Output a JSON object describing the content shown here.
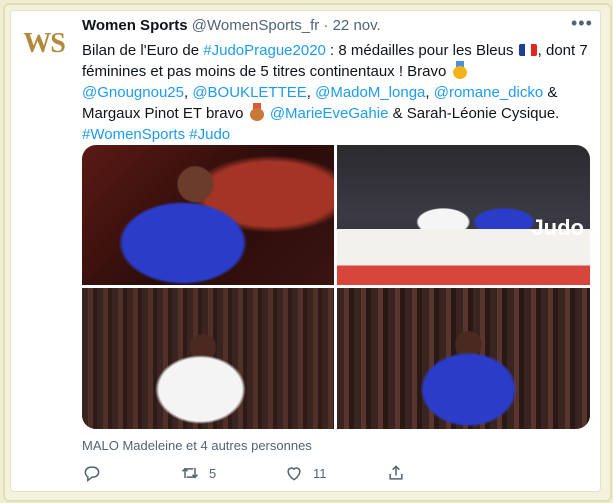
{
  "tweet": {
    "avatar_initials": "WS",
    "author_name": "Women Sports",
    "handle": "@WomenSports_fr",
    "separator": "·",
    "date": "22 nov.",
    "more_icon": "ellipsis-icon",
    "text": {
      "part1": "Bilan de l'Euro de ",
      "tag1": "#JudoPrague2020",
      "part2": " : 8 médailles pour les Bleus ",
      "part3": ", dont 7 féminines et pas moins de 5 titres continentaux ! Bravo ",
      "m1": "@Gnougnou25",
      "c1": ", ",
      "m2": "@BOUKLETTEE",
      "c2": ", ",
      "m3": "@MadoM_longa",
      "c3": ", ",
      "m4": "@romane_dicko",
      "part4": " & Margaux Pinot ET bravo ",
      "m5": "@MarieEveGahie",
      "part5": " & Sarah-Léonie Cysique.",
      "tag2": "#WomenSports",
      "tag3": "#Judo"
    },
    "photos": [
      {
        "name": "judoka-praying"
      },
      {
        "name": "judo-match"
      },
      {
        "name": "judoka-white-celebrating"
      },
      {
        "name": "judoka-blue-celebrating"
      }
    ],
    "photo2_sign": "Judo",
    "liked_by": "MALO Madeleine et 4 autres personnes",
    "actions": {
      "reply_icon": "reply-icon",
      "retweet_icon": "retweet-icon",
      "retweet_count": "5",
      "like_icon": "heart-icon",
      "like_count": "11",
      "share_icon": "share-icon"
    }
  },
  "colors": {
    "link": "#1d9bf0",
    "muted": "#536471",
    "frame_bg": "#efeed2"
  }
}
